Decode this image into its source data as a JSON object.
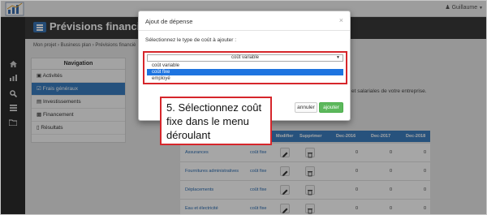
{
  "app": {
    "title": "Prévisions financières",
    "user_name": "Guillaume"
  },
  "breadcrumb": [
    "Mon projet",
    "Business plan",
    "Prévisions financiè"
  ],
  "breadcrumb_text": "Mon projet  ›  Business plan  ›  Prévisions financiè",
  "rail_icons": [
    "home-icon",
    "chart-icon",
    "search-icon",
    "list-icon",
    "folder-icon"
  ],
  "navigation": {
    "title": "Navigation",
    "items": [
      {
        "label": "Activités",
        "icon": "cart-icon",
        "active": false
      },
      {
        "label": "Frais généraux",
        "icon": "check-square-icon",
        "active": true
      },
      {
        "label": "Investissements",
        "icon": "building-icon",
        "active": false
      },
      {
        "label": "Financement",
        "icon": "money-icon",
        "active": false
      },
      {
        "label": "Résultats",
        "icon": "bar-chart-icon",
        "active": false
      }
    ]
  },
  "content": {
    "text": "et salariales de votre entreprise."
  },
  "table": {
    "headers": [
      "Modifier",
      "Supprimer",
      "Dec-2016",
      "Dec-2017",
      "Dec-2018"
    ],
    "rows": [
      {
        "name": "Assurances",
        "type": "coût fixe",
        "v2016": "0",
        "v2017": "0",
        "v2018": "0"
      },
      {
        "name": "Fournitures administratives",
        "type": "coût fixe",
        "v2016": "0",
        "v2017": "0",
        "v2018": "0"
      },
      {
        "name": "Déplacements",
        "type": "coût fixe",
        "v2016": "0",
        "v2017": "0",
        "v2018": "0"
      },
      {
        "name": "Eau et électricité",
        "type": "coût fixe",
        "v2016": "0",
        "v2017": "0",
        "v2018": "0"
      }
    ]
  },
  "modal": {
    "title": "Ajout de dépense",
    "close": "×",
    "label": "Sélectionnez le type de coût à ajouter :",
    "select_value": "coût variable",
    "options": [
      {
        "label": "coût variable",
        "selected": false
      },
      {
        "label": "coût fixe",
        "selected": true
      },
      {
        "label": "employé",
        "selected": false
      }
    ],
    "cancel_label": "annuler",
    "add_label": "ajouter"
  },
  "callout": {
    "text": "5. Sélectionnez coût fixe dans le menu déroulant"
  },
  "colors": {
    "accent": "#3a7dc0",
    "highlight": "#d6262b",
    "success": "#5cb85c",
    "rail": "#2c2c2c"
  }
}
